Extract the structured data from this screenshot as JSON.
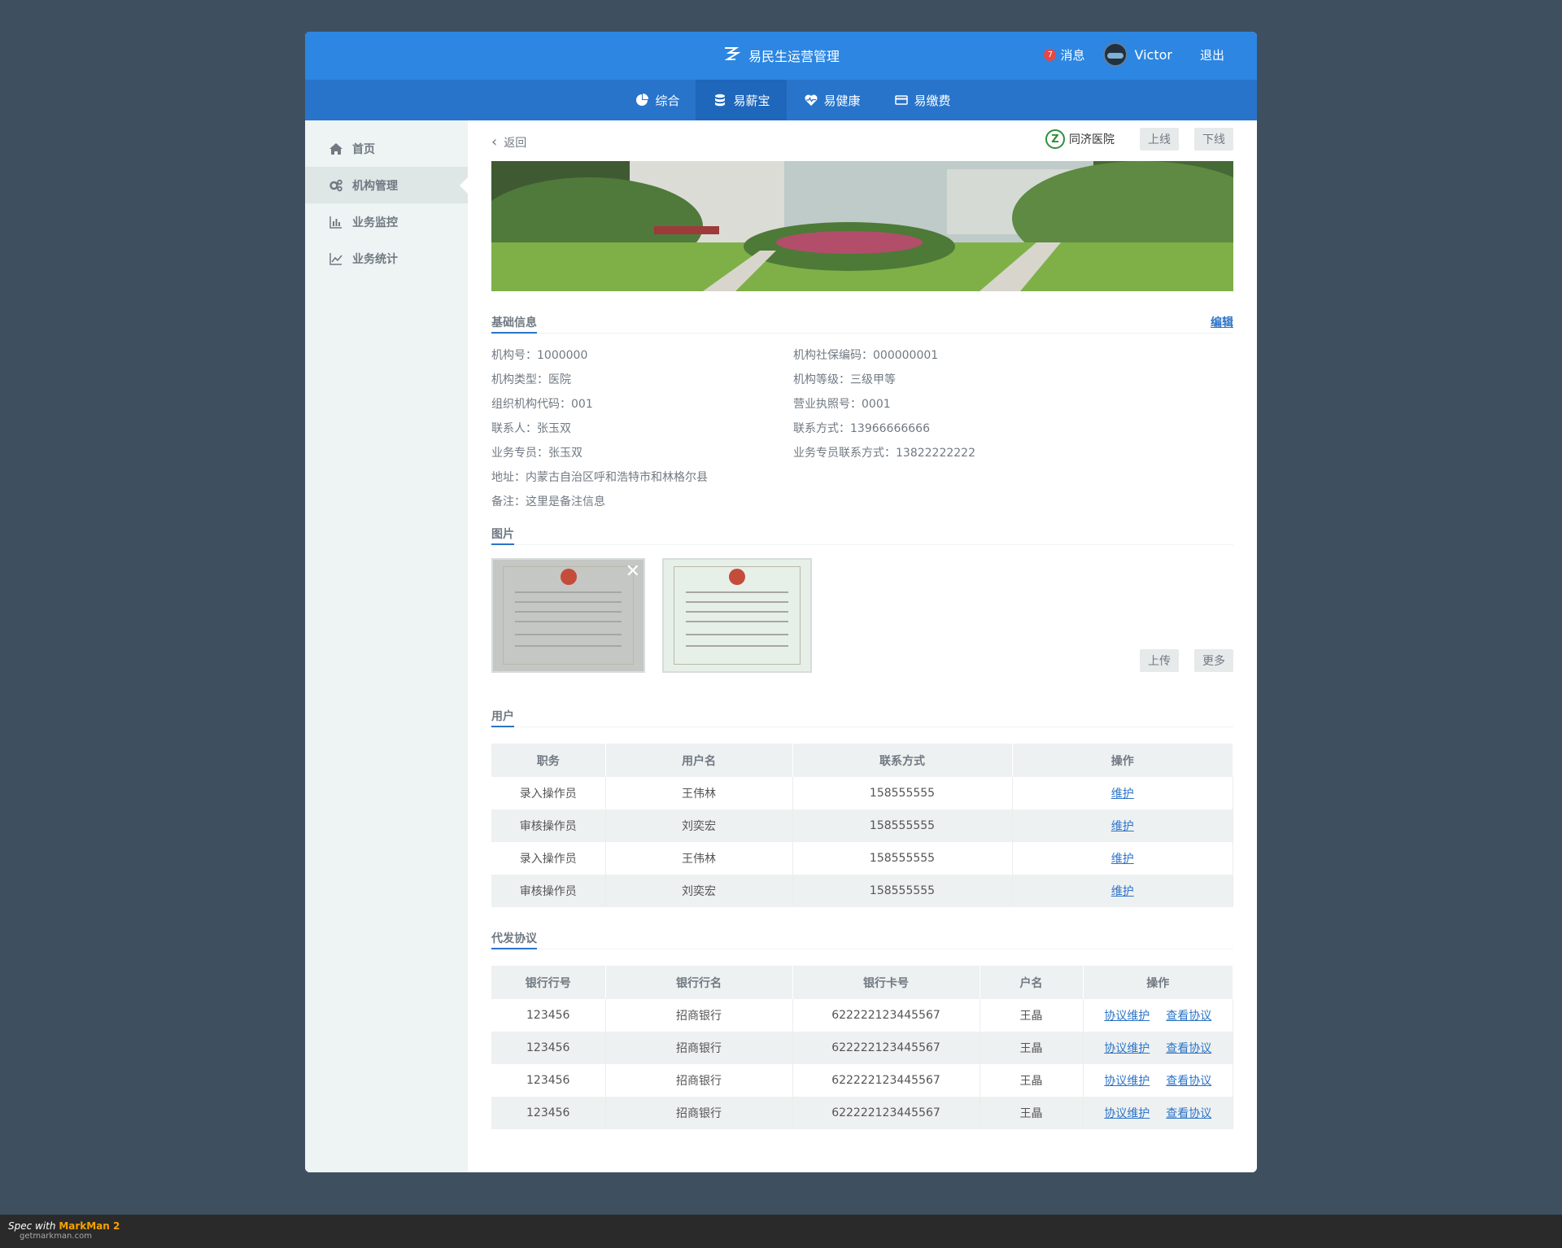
{
  "header": {
    "title": "易民生运营管理",
    "messages_label": "消息",
    "messages_count": "7",
    "username": "Victor",
    "logout_label": "退出"
  },
  "nav": {
    "tabs": [
      {
        "label": "综合",
        "icon": "pie-chart-icon"
      },
      {
        "label": "易薪宝",
        "icon": "database-icon"
      },
      {
        "label": "易健康",
        "icon": "heart-pulse-icon"
      },
      {
        "label": "易缴费",
        "icon": "credit-card-icon"
      }
    ],
    "active_index": 1
  },
  "sidebar": {
    "items": [
      {
        "label": "首页",
        "icon": "home-icon"
      },
      {
        "label": "机构管理",
        "icon": "gears-icon"
      },
      {
        "label": "业务监控",
        "icon": "bar-chart-icon"
      },
      {
        "label": "业务统计",
        "icon": "line-chart-icon"
      }
    ],
    "active_index": 1
  },
  "page": {
    "back_label": "返回",
    "org_name": "同济医院",
    "online_label": "上线",
    "offline_label": "下线",
    "basic_info_title": "基础信息",
    "edit_label": "编辑",
    "info": {
      "org_no": "机构号：1000000",
      "social_code": "机构社保编码：000000001",
      "org_type": "机构类型：医院",
      "org_level": "机构等级：三级甲等",
      "org_code": "组织机构代码：001",
      "license_no": "营业执照号：0001",
      "contact": "联系人：张玉双",
      "phone": "联系方式：13966666666",
      "agent": "业务专员：张玉双",
      "agent_phone": "业务专员联系方式：13822222222",
      "address": "地址：内蒙古自治区呼和浩特市和林格尔县",
      "remark": "备注：这里是备注信息"
    },
    "pictures_title": "图片",
    "upload_label": "上传",
    "more_label": "更多",
    "users_title": "用户",
    "agreements_title": "代发协议"
  },
  "users_table": {
    "headers": [
      "职务",
      "用户名",
      "联系方式",
      "操作"
    ],
    "rows": [
      [
        "录入操作员",
        "王伟林",
        "158555555",
        "维护"
      ],
      [
        "审核操作员",
        "刘奕宏",
        "158555555",
        "维护"
      ],
      [
        "录入操作员",
        "王伟林",
        "158555555",
        "维护"
      ],
      [
        "审核操作员",
        "刘奕宏",
        "158555555",
        "维护"
      ]
    ]
  },
  "agreements_table": {
    "headers": [
      "银行行号",
      "银行行名",
      "银行卡号",
      "户名",
      "操作"
    ],
    "rows": [
      [
        "123456",
        "招商银行",
        "622222123445567",
        "王晶",
        "协议维护",
        "查看协议"
      ],
      [
        "123456",
        "招商银行",
        "622222123445567",
        "王晶",
        "协议维护",
        "查看协议"
      ],
      [
        "123456",
        "招商银行",
        "622222123445567",
        "王晶",
        "协议维护",
        "查看协议"
      ],
      [
        "123456",
        "招商银行",
        "622222123445567",
        "王晶",
        "协议维护",
        "查看协议"
      ]
    ]
  },
  "watermark": {
    "line1_a": "Spec with ",
    "line1_b": "MarkMan 2",
    "line2": "getmarkman.com"
  }
}
